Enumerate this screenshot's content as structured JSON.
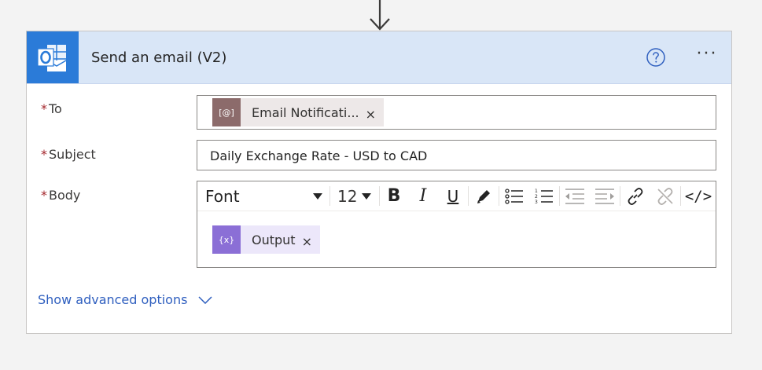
{
  "card": {
    "title": "Send an email (V2)",
    "help_icon": "question-circle-icon",
    "more_icon": "ellipsis-icon",
    "more_label": "···"
  },
  "fields": {
    "to": {
      "required_mark": "*",
      "label": "To",
      "token_icon_text": "[@]",
      "token_label": "Email Notificati...",
      "token_close": "×",
      "token_color": "#8c6b6b"
    },
    "subject": {
      "required_mark": "*",
      "label": "Subject",
      "value": "Daily Exchange Rate - USD to CAD"
    },
    "body": {
      "required_mark": "*",
      "label": "Body",
      "font_select": "Font",
      "size_select": "12",
      "token_icon_text": "{x}",
      "token_label": "Output",
      "token_close": "×",
      "token_color": "#8b6fd6"
    }
  },
  "toolbar": {
    "bold": "B",
    "italic": "I",
    "underline": "U",
    "code": "</>"
  },
  "advanced": {
    "label": "Show advanced options"
  },
  "colors": {
    "accent": "#2b7bd8",
    "header_bg": "#d9e6f7",
    "link": "#2f5fbf",
    "required": "#a4262c"
  }
}
